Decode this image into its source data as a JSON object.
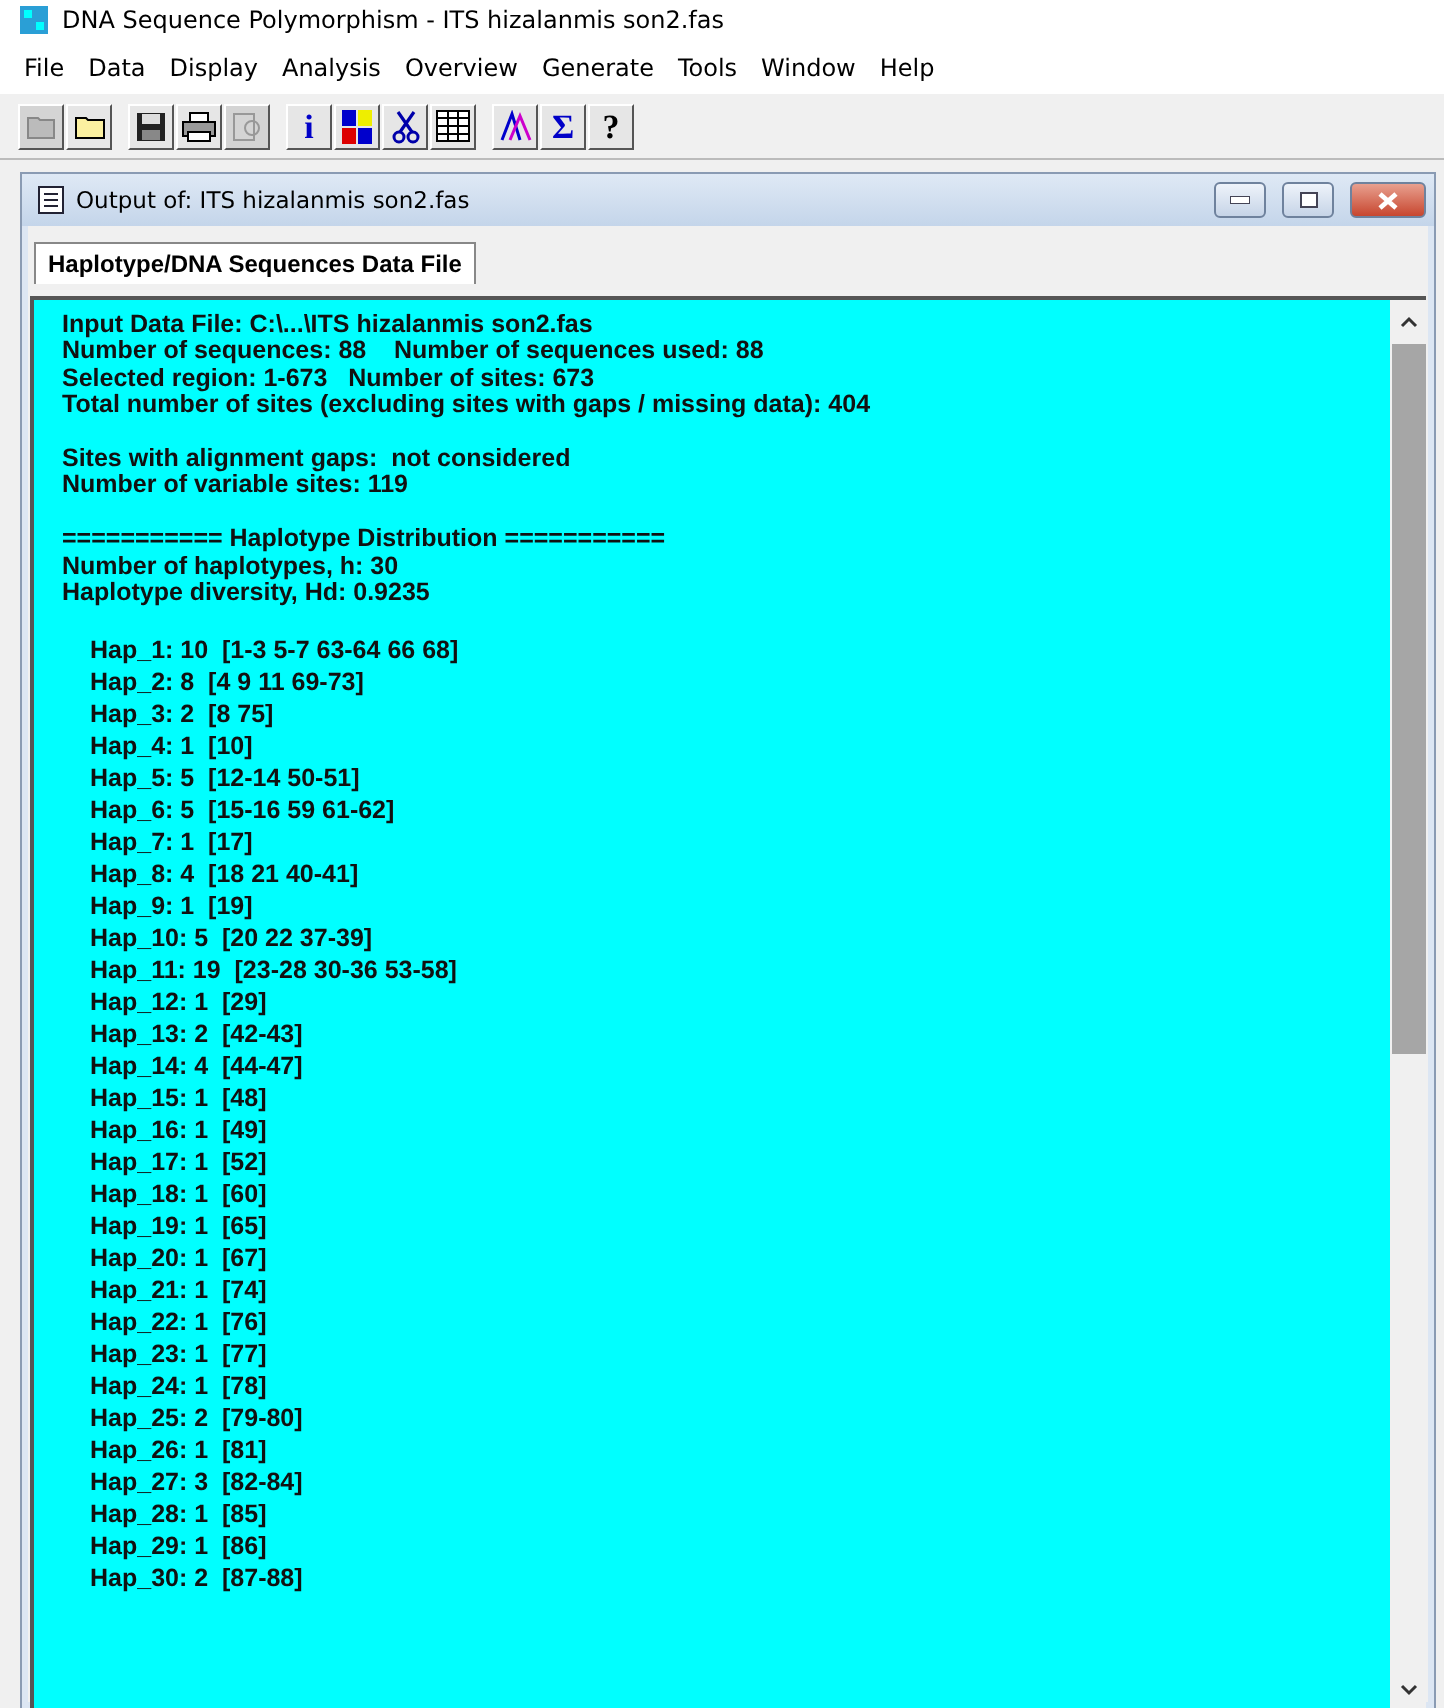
{
  "window": {
    "title": "DNA Sequence Polymorphism - ITS hizalanmis son2.fas"
  },
  "menu": [
    "File",
    "Data",
    "Display",
    "Analysis",
    "Overview",
    "Generate",
    "Tools",
    "Window",
    "Help"
  ],
  "toolbar": [
    [
      {
        "kind": "open",
        "disabled": true
      },
      {
        "kind": "folder",
        "disabled": false
      }
    ],
    [
      {
        "kind": "save",
        "disabled": false
      },
      {
        "kind": "print",
        "disabled": false
      },
      {
        "kind": "preview",
        "disabled": true
      }
    ],
    [
      {
        "kind": "glyph",
        "glyph": "i",
        "disabled": false
      },
      {
        "kind": "blocks",
        "disabled": false
      },
      {
        "kind": "scissors",
        "disabled": false
      },
      {
        "kind": "grid",
        "disabled": false
      }
    ],
    [
      {
        "kind": "peaks",
        "disabled": false
      },
      {
        "kind": "glyph",
        "glyph": "Σ",
        "disabled": false
      },
      {
        "kind": "glyph",
        "glyph": "?",
        "disabled": false
      }
    ]
  ],
  "child_window": {
    "title": "Output of: ITS hizalanmis son2.fas",
    "tab": {
      "label": "Haplotype/DNA Sequences Data File",
      "selected": true
    },
    "sections": [
      [
        "Input Data File: C:\\...\\ITS hizalanmis son2.fas",
        "Number of sequences: 88    Number of sequences used: 88",
        "Selected region: 1-673   Number of sites: 673",
        "Total number of sites (excluding sites with gaps / missing data): 404"
      ],
      [
        "Sites with alignment gaps:  not considered",
        "Number of variable sites: 119"
      ],
      [
        "=========== Haplotype Distribution ===========",
        "Number of haplotypes, h: 30",
        "Haplotype diversity, Hd: 0.9235"
      ]
    ],
    "haplotypes": [
      "Hap_1: 10  [1-3 5-7 63-64 66 68]",
      "Hap_2: 8  [4 9 11 69-73]",
      "Hap_3: 2  [8 75]",
      "Hap_4: 1  [10]",
      "Hap_5: 5  [12-14 50-51]",
      "Hap_6: 5  [15-16 59 61-62]",
      "Hap_7: 1  [17]",
      "Hap_8: 4  [18 21 40-41]",
      "Hap_9: 1  [19]",
      "Hap_10: 5  [20 22 37-39]",
      "Hap_11: 19  [23-28 30-36 53-58]",
      "Hap_12: 1  [29]",
      "Hap_13: 2  [42-43]",
      "Hap_14: 4  [44-47]",
      "Hap_15: 1  [48]",
      "Hap_16: 1  [49]",
      "Hap_17: 1  [52]",
      "Hap_18: 1  [60]",
      "Hap_19: 1  [65]",
      "Hap_20: 1  [67]",
      "Hap_21: 1  [74]",
      "Hap_22: 1  [76]",
      "Hap_23: 1  [77]",
      "Hap_24: 1  [78]",
      "Hap_25: 2  [79-80]",
      "Hap_26: 1  [81]",
      "Hap_27: 3  [82-84]",
      "Hap_28: 1  [85]",
      "Hap_29: 1  [86]",
      "Hap_30: 2  [87-88]"
    ]
  }
}
